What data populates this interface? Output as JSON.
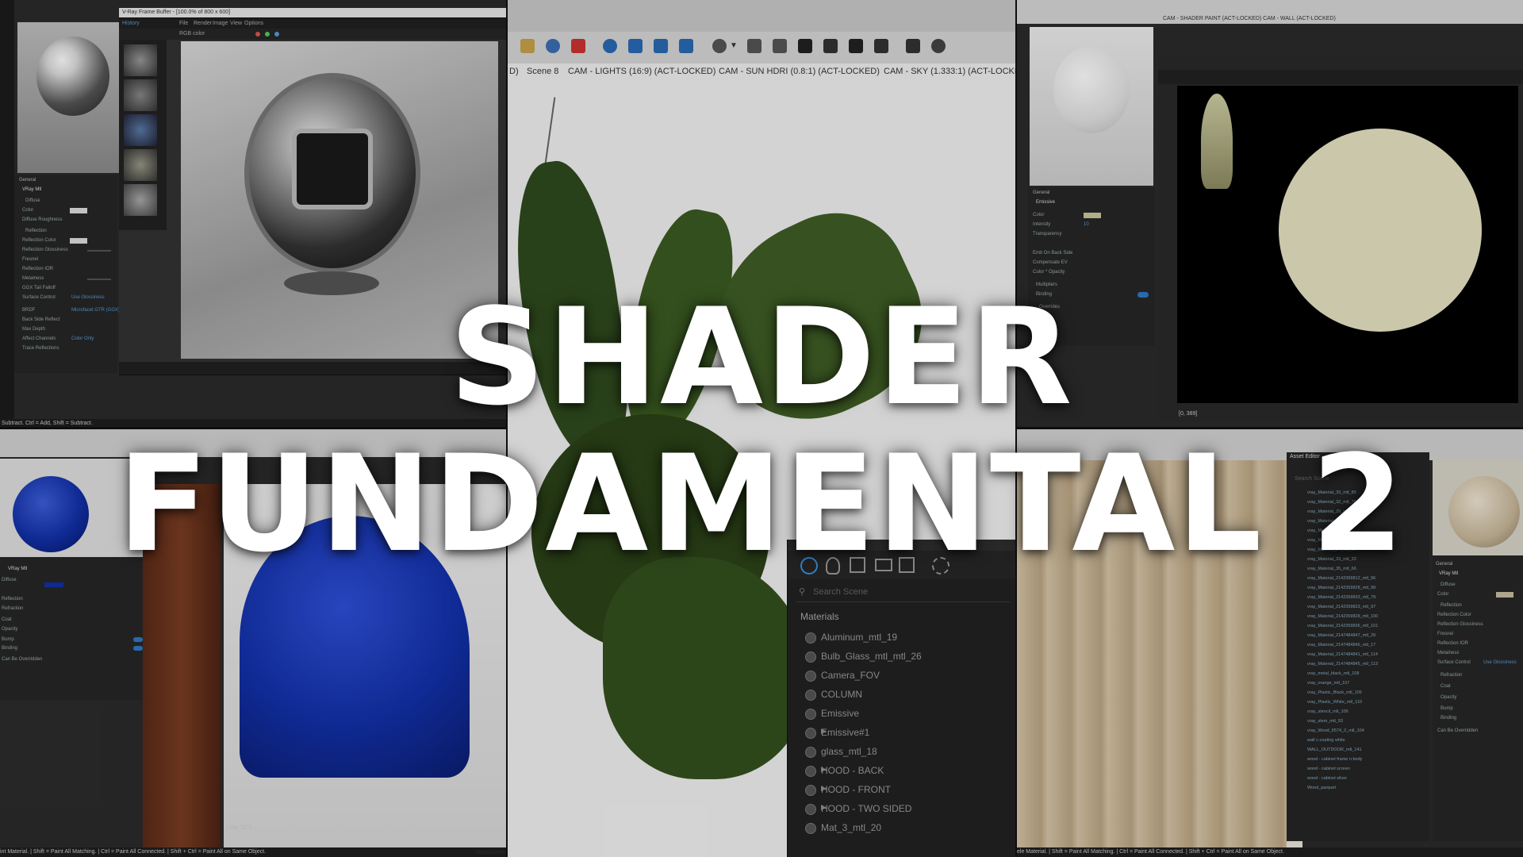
{
  "title": {
    "line1": "SHADER",
    "line2": "FUNDAMENTAL 2"
  },
  "top_left": {
    "window_title": "V-Ray Frame Buffer - [100.0% of 800 x 600]",
    "menu": [
      "File",
      "Render",
      "Image",
      "View",
      "Options"
    ],
    "history_label": "History",
    "channel": "RGB color",
    "section": "General",
    "material_name": "VRay Mtl",
    "props": [
      "Diffuse",
      "Color",
      "Diffuse Roughness",
      "Reflection",
      "Reflection Color",
      "Reflection Glossiness",
      "Fresnel",
      "Reflection IOR",
      "Metalness",
      "GGX Tail Falloff",
      "Surface Control",
      "BRDF",
      "Back Side Reflect",
      "Max Depth",
      "Affect Channels",
      "Trace Reflections"
    ],
    "surface_value": "Use Glossiness",
    "brdf_value": "Microfacet GTR (GGX)",
    "affect_value": "Color Only",
    "status": "Subtract. Ctrl = Add, Shift = Subtract."
  },
  "center": {
    "tabs": [
      "D)",
      "Scene 8",
      "CAM - LIGHTS (16:9) (ACT-LOCKED)",
      "CAM - SUN  HDRI (0.8:1) (ACT-LOCKED)",
      "CAM - SKY (1.333:1) (ACT-LOCKE"
    ],
    "search_placeholder": "Search Scene",
    "materials_header": "Materials",
    "materials": [
      "Aluminum_mtl_19",
      "Bulb_Glass_mtl_mtl_26",
      "Camera_FOV",
      "COLUMN",
      "Emissive",
      "Emissive#1",
      "glass_mtl_18",
      "HOOD - BACK",
      "HOOD - FRONT",
      "HOOD - TWO SIDED",
      "Mat_3_mtl_20"
    ],
    "expandable": [
      5,
      7,
      8,
      9
    ]
  },
  "top_right": {
    "tabs": "CAM - SHADER PAINT (ACT-LOCKED)  CAM - WALL (ACT-LOCKED)",
    "section": "General",
    "material_name": "Emissive",
    "props": [
      "Color",
      "Intensity",
      "Transparency",
      "Emit On Back Side",
      "Compensate EV",
      "Color * Opacity",
      "Multipliers",
      "Binding",
      "Overrides"
    ],
    "intensity_value": "10",
    "status": "[0, 389]"
  },
  "bottom_left": {
    "material_name": "VRay Mtl",
    "props": [
      "Diffuse",
      "Reflection",
      "Refraction",
      "Coat",
      "Opacity",
      "Bump",
      "Binding",
      "Can Be Overridden"
    ],
    "status_coords": "[398, 357]",
    "status": "int Material. | Shift = Paint All Matching. | Ctrl = Paint All Connected. | Shift + Ctrl = Paint All on Same Object.",
    "measure_label": "Measureme"
  },
  "bottom_right": {
    "window_title": "Asset Editor",
    "search_placeholder": "Search Scene",
    "scene_items": [
      "vray_Material_33_mtl_85",
      "vray_Material_32_mtl_76",
      "vray_Material_29_mtl_42",
      "vray_Material_25_mtl",
      "vray_Material_31_mtl",
      "vray_Material_31_mtl_9",
      "vray_Material_34_mtl_14",
      "vray_Material_33_mtl_33",
      "vray_Material_35_mtl_66",
      "vray_Material_2142359812_mtl_96",
      "vray_Material_2142359828_mtl_98",
      "vray_Material_2142359833_mtl_79",
      "vray_Material_2142359823_mtl_97",
      "vray_Material_2142359828_mtl_100",
      "vray_Material_2142359836_mtl_101",
      "vray_Material_2147484847_mtl_29",
      "vray_Material_2147484846_mtl_17",
      "vray_Material_2147484841_mtl_114",
      "vray_Material_2147484845_mtl_113",
      "vray_metal_black_mtl_108",
      "vray_orange_mtl_107",
      "vray_Plastic_Black_mtl_105",
      "vray_Plastic_White_mtl_110",
      "vray_stencil_mtl_106",
      "vray_stem_mtl_93",
      "vray_Wood_6574_2_mtl_104",
      "wall c-coating white",
      "WALL_OUTDOOR_mtl_141",
      "wood - cabinet frame n body",
      "wood - cabinet screen",
      "wood - cabinet silver",
      "Wood_parquet"
    ],
    "section": "General",
    "material_name": "VRay Mtl",
    "props": [
      "Diffuse",
      "Color",
      "Reflection",
      "Reflection Color",
      "Reflection Glossiness",
      "Fresnel",
      "Reflection IOR",
      "Metalness",
      "Surface Control",
      "Refraction",
      "Coat",
      "Opacity",
      "Bump",
      "Binding",
      "Can Be Overridden"
    ],
    "surface_value": "Use Glossiness",
    "status": "ele Material. | Shift = Paint All Matching. | Ctrl = Paint All Connected. | Shift + Ctrl = Paint All on Same Object."
  },
  "colors": {
    "accent_blue": "#2f78c8",
    "panel_dark": "#2b2b2b",
    "cloth_blue": "#1230a8",
    "emissive_disc": "#e6e3c3"
  }
}
